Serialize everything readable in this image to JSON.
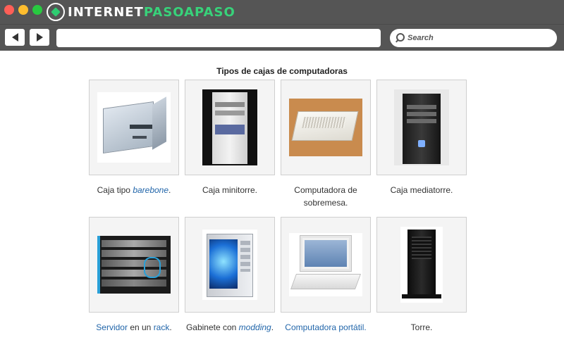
{
  "browser": {
    "logo_part1": "INTERNET",
    "logo_part2": "PASOAPASO",
    "search_placeholder": "Search",
    "url_value": ""
  },
  "page": {
    "title": "Tipos de cajas de computadoras",
    "items": [
      {
        "img": "computer-case-barebone-image",
        "text_pre": "Caja tipo ",
        "link": "barebone",
        "text_post": "."
      },
      {
        "img": "computer-case-minitower-image",
        "text": "Caja minitorre."
      },
      {
        "img": "computer-case-desktop-image",
        "text": "Computadora de sobremesa."
      },
      {
        "img": "computer-case-midtower-image",
        "text": "Caja mediatorre."
      },
      {
        "img": "computer-case-rack-server-image",
        "link1": "Servidor",
        "text_mid": " en un ",
        "link2": "rack",
        "text_post": "."
      },
      {
        "img": "computer-case-modding-image",
        "text_pre": "Gabinete con ",
        "link": "modding",
        "text_post": "."
      },
      {
        "img": "laptop-image",
        "link": "Computadora portátil",
        "text_post": "."
      },
      {
        "img": "computer-case-tower-image",
        "text": "Torre."
      }
    ]
  },
  "colors": {
    "titlebar_bg": "#555555",
    "logo_accent": "#38d27a",
    "link_color": "#2266aa"
  }
}
